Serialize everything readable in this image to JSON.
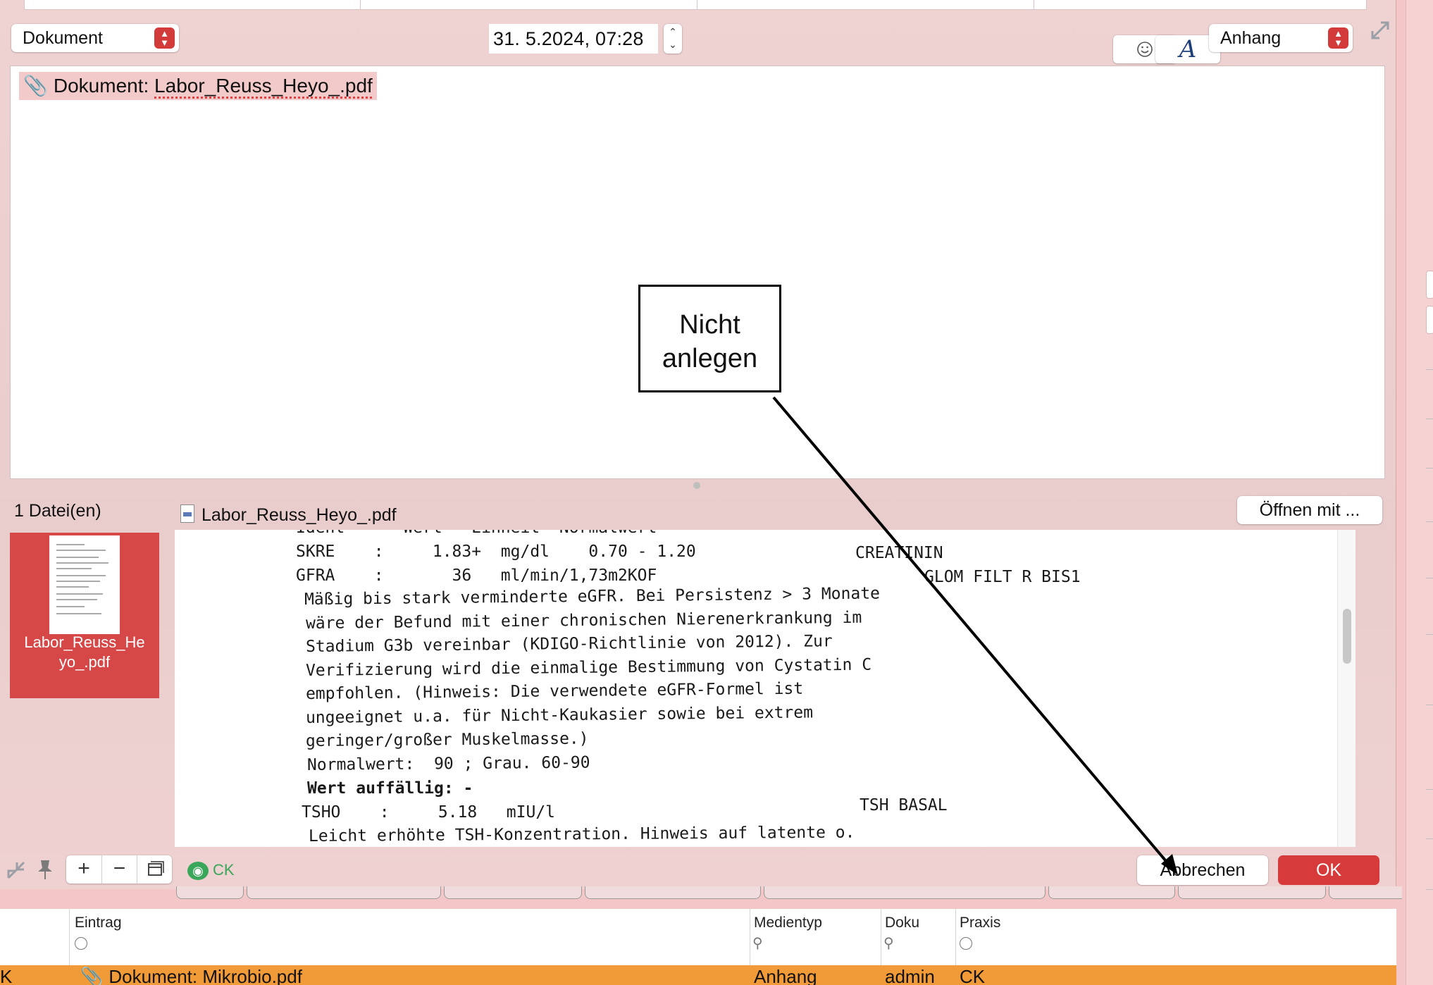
{
  "toolbar": {
    "type_select": "Dokument",
    "date_time": "31.  5.2024, 07:28",
    "category_select": "Anhang",
    "emoji_icon": "smiley-icon",
    "font_icon_glyph": "A"
  },
  "editor": {
    "entry_prefix": "Dokument: ",
    "entry_filename": "Labor_Reuss_Heyo_.pdf"
  },
  "annotation": {
    "callout_line1": "Nicht",
    "callout_line2": "anlegen"
  },
  "attachments": {
    "count_label": "1 Datei(en)",
    "preview_title": "Labor_Reuss_Heyo_.pdf",
    "open_with_button": "Öffnen mit ...",
    "thumbnail_label_line1": "Labor_Reuss_He",
    "thumbnail_label_line2": "yo_.pdf"
  },
  "pdf_content": {
    "lines": [
      "Ident      Wert   Einheit  Normalwert",
      "SKRE    :     1.83+  mg/dl    0.70 - 1.20",
      "GFRA    :       36   ml/min/1,73m2KOF",
      "Mäßig bis stark verminderte eGFR. Bei Persistenz > 3 Monate",
      "wäre der Befund mit einer chronischen Nierenerkrankung im",
      "Stadium G3b vereinbar (KDIGO-Richtlinie von 2012). Zur",
      "Verifizierung wird die einmalige Bestimmung von Cystatin C",
      "empfohlen. (Hinweis: Die verwendete eGFR-Formel ist",
      "ungeeignet u.a. für Nicht-Kaukasier sowie bei extrem",
      "geringer/großer Muskelmasse.)",
      "Normalwert:  90 ; Grau. 60-90",
      "Wert auffällig: -",
      "TSHO    :     5.18   mIU/l",
      "Leicht erhöhte TSH-Konzentration. Hinweis auf latente o."
    ],
    "right_labels": [
      "CREATININ",
      "GLOM FILT R BIS1",
      "TSH BASAL"
    ]
  },
  "bottom_bar": {
    "add_label": "+",
    "remove_label": "−",
    "ck_label": "CK",
    "cancel_button": "Abbrechen",
    "ok_button": "OK"
  },
  "table": {
    "columns": [
      "Eintrag",
      "Medientyp",
      "Doku",
      "Praxis"
    ],
    "row": {
      "prefix": "K",
      "entry": "Dokument: Mikrobio.pdf",
      "media_type": "Anhang",
      "doku": "admin",
      "praxis": "CK"
    }
  },
  "colors": {
    "accent_red": "#d63a3a",
    "highlight_row": "#f19a38",
    "ck_green": "#3aa65a"
  }
}
